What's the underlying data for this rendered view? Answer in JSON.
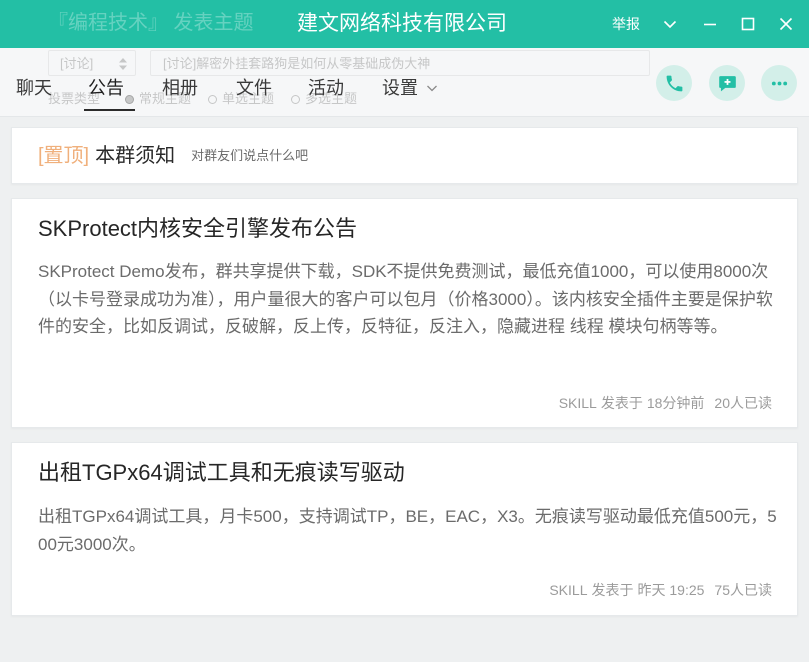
{
  "window": {
    "title": "建文网络科技有限公司",
    "report_label": "举报",
    "accent_color": "#23bfa5",
    "controls": {
      "menu_icon": "chevron-down-icon",
      "minimize_icon": "minimize-icon",
      "maximize_icon": "maximize-icon",
      "close_icon": "close-icon"
    }
  },
  "ghost_overlay": {
    "compose_title": "『编程技术』 发表主题",
    "category_select": "[讨论]",
    "subject_input": "[讨论]解密外挂套路狗是如何从零基础成伪大神",
    "vote_type_label": "投票类型",
    "vote_options": [
      "常规主题",
      "单选主题",
      "多选主题"
    ],
    "vote_selected": "常规主题"
  },
  "tabs": [
    {
      "label": "聊天",
      "active": false
    },
    {
      "label": "公告",
      "active": true
    },
    {
      "label": "相册",
      "active": false
    },
    {
      "label": "文件",
      "active": false
    },
    {
      "label": "活动",
      "active": false
    },
    {
      "label": "设置",
      "active": false,
      "menu_icon": "chevron-down-icon"
    }
  ],
  "toolbar_actions": [
    {
      "icon": "phone-icon"
    },
    {
      "icon": "new-message-icon"
    },
    {
      "icon": "more-icon"
    }
  ],
  "pinned": {
    "badge": "[置顶]",
    "title": "本群须知",
    "hint": "对群友们说点什么吧",
    "badge_color": "#f0b07c"
  },
  "announcements": [
    {
      "title": "SKProtect内核安全引擎发布公告",
      "body": "SKProtect Demo发布，群共享提供下载，SDK不提供免费测试，最低充值1000，可以使用8000次（以卡号登录成功为准），用户量很大的客户可以包月（价格3000）。该内核安全插件主要是保护软件的安全，比如反调试，反破解，反上传，反特征，反注入，隐藏进程 线程 模块句柄等等。",
      "author": "SKILL",
      "posted_label": "发表于",
      "time": "18分钟前",
      "reads": "20人已读"
    },
    {
      "title": "出租TGPx64调试工具和无痕读写驱动",
      "body": "出租TGPx64调试工具，月卡500，支持调试TP，BE，EAC，X3。无痕读写驱动最低充值500元，500元3000次。",
      "author": "SKILL",
      "posted_label": "发表于",
      "time": "昨天 19:25",
      "reads": "75人已读"
    }
  ]
}
